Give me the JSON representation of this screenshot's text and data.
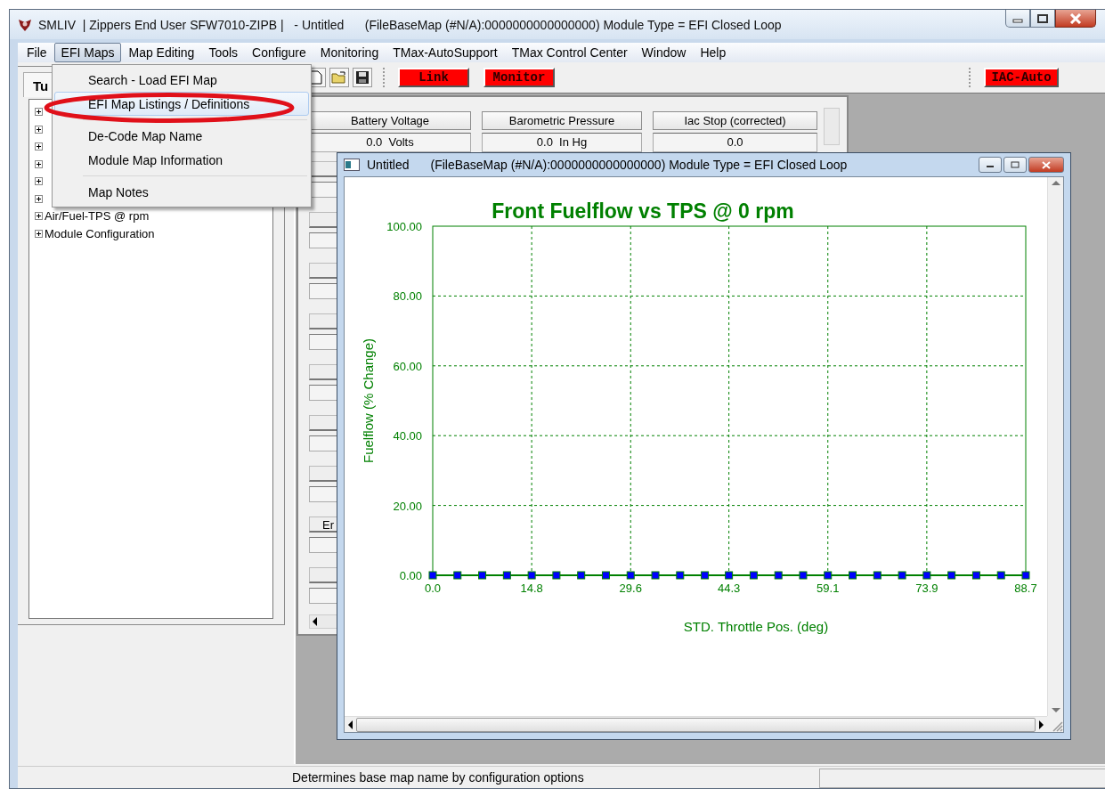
{
  "window": {
    "title": "SMLIV  | Zippers End User SFW7010-ZIPB |   - Untitled      (FileBaseMap (#N/A):0000000000000000) Module Type = EFI Closed Loop"
  },
  "menu": [
    {
      "label": "File",
      "selected": false
    },
    {
      "label": "EFI Maps",
      "selected": true
    },
    {
      "label": "Map Editing",
      "selected": false
    },
    {
      "label": "Tools",
      "selected": false
    },
    {
      "label": "Configure",
      "selected": false
    },
    {
      "label": "Monitoring",
      "selected": false
    },
    {
      "label": "TMax-AutoSupport",
      "selected": false
    },
    {
      "label": "TMax Control Center",
      "selected": false
    },
    {
      "label": "Window",
      "selected": false
    },
    {
      "label": "Help",
      "selected": false
    }
  ],
  "efi_maps_menu": [
    {
      "kind": "item",
      "label": "Search - Load EFI Map",
      "selected": false
    },
    {
      "kind": "item",
      "label": "EFI Map Listings / Definitions",
      "selected": true
    },
    {
      "kind": "separator"
    },
    {
      "kind": "item",
      "label": "De-Code Map Name",
      "selected": false
    },
    {
      "kind": "item",
      "label": "Module Map Information",
      "selected": false
    },
    {
      "kind": "separator"
    },
    {
      "kind": "item",
      "label": "Map Notes",
      "selected": false
    }
  ],
  "toolbar": {
    "buttons": [
      "Link",
      "Monitor"
    ],
    "right_button": "IAC-Auto"
  },
  "left_panel": {
    "tab": "Tu",
    "tree": [
      {
        "expanded": false
      },
      {
        "expanded": false
      },
      {
        "expanded": false
      },
      {
        "expanded": false
      },
      {
        "expanded": false
      },
      {
        "expanded": false
      },
      {
        "label": "Air/Fuel-TPS @ rpm",
        "expanded": false
      },
      {
        "label": "Module Configuration",
        "expanded": false
      }
    ]
  },
  "gauges": {
    "columns": [
      {
        "header": "Battery Voltage",
        "value": "0.0  Volts"
      },
      {
        "header": "Barometric Pressure",
        "value": "0.0  In Hg"
      },
      {
        "header": "Iac Stop (corrected)",
        "value": "0.0"
      }
    ],
    "partial_header": "Er"
  },
  "chart_window": {
    "title": "Untitled",
    "subtitle": "(FileBaseMap (#N/A):0000000000000000) Module Type = EFI Closed Loop",
    "chart_data": {
      "type": "line",
      "title": "Front Fuelflow vs TPS @ 0 rpm",
      "xlabel": "STD. Throttle Pos. (deg)",
      "ylabel": "Fuelflow (% Change)",
      "x": [
        0.0,
        3.7,
        7.4,
        11.1,
        14.8,
        18.5,
        22.2,
        25.9,
        29.6,
        33.3,
        37.0,
        40.7,
        44.3,
        48.0,
        51.7,
        55.4,
        59.1,
        62.8,
        66.5,
        70.2,
        73.9,
        77.6,
        81.3,
        85.0,
        88.7
      ],
      "grid": true,
      "series": [
        {
          "color": "#0000ff",
          "marker": "square",
          "values": [
            0,
            0,
            0,
            0,
            0,
            0,
            0,
            0,
            0,
            0,
            0,
            0,
            0,
            0,
            0,
            0,
            0,
            0,
            0,
            0,
            0,
            0,
            0,
            0,
            0
          ]
        }
      ],
      "xlim": [
        0,
        88.7
      ],
      "ylim": [
        0,
        100
      ],
      "xticks": [
        {
          "value": 0,
          "label": "0.0"
        },
        {
          "value": 14.8,
          "label": "14.8"
        },
        {
          "value": 29.6,
          "label": "29.6"
        },
        {
          "value": 44.3,
          "label": "44.3"
        },
        {
          "value": 59.1,
          "label": "59.1"
        },
        {
          "value": 73.9,
          "label": "73.9"
        },
        {
          "value": 88.7,
          "label": "88.7"
        }
      ],
      "yticks": [
        {
          "value": 0,
          "label": "0.00"
        },
        {
          "value": 20,
          "label": "20.00"
        },
        {
          "value": 40,
          "label": "40.00"
        },
        {
          "value": 60,
          "label": "60.00"
        },
        {
          "value": 80,
          "label": "80.00"
        },
        {
          "value": 100,
          "label": "100.00"
        }
      ]
    }
  },
  "status_bar": {
    "message": "Determines base map name by configuration options"
  }
}
